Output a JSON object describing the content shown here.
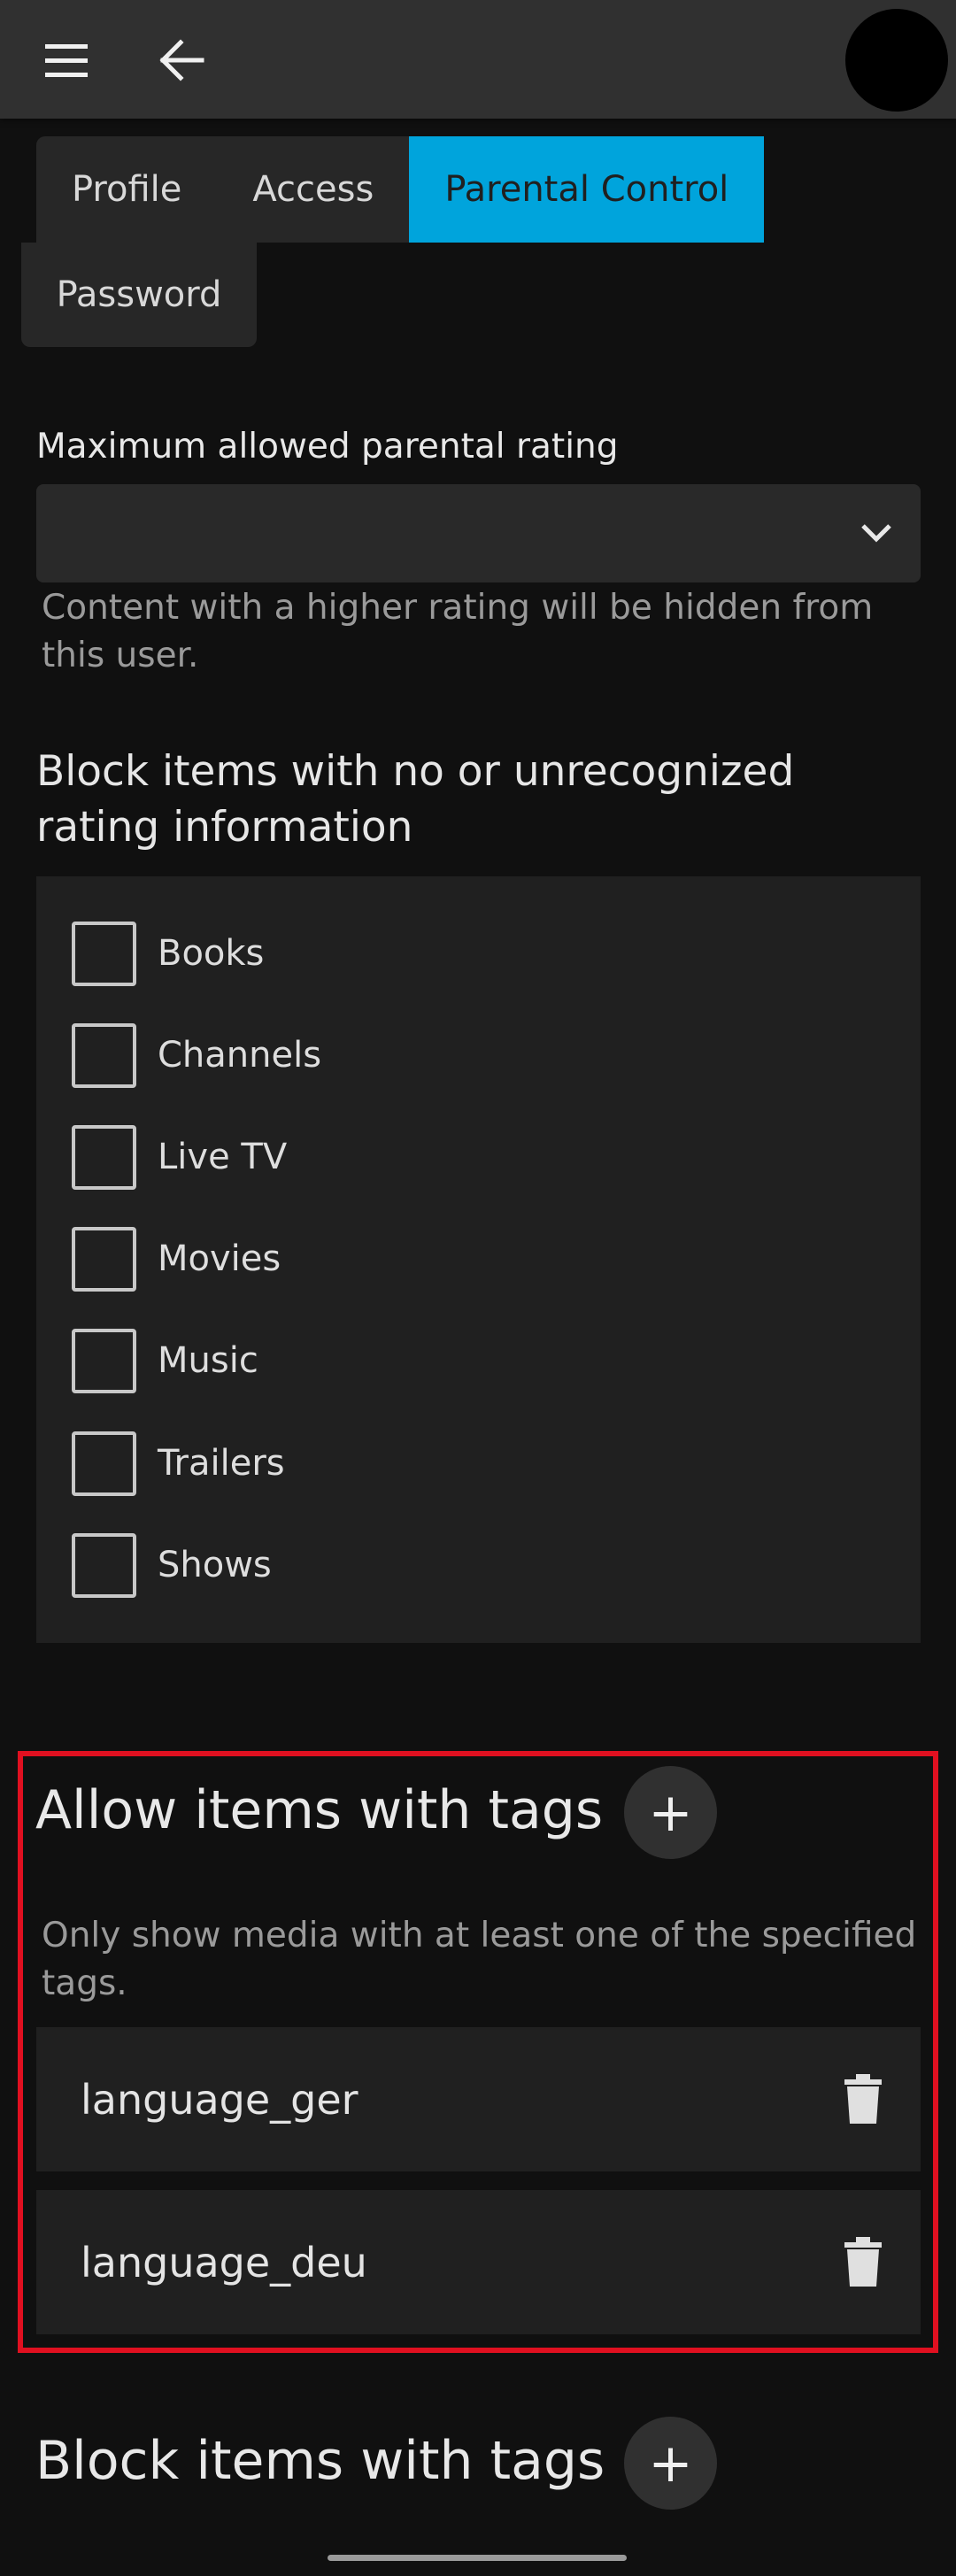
{
  "tabs": [
    "Profile",
    "Access",
    "Parental Control",
    "Password"
  ],
  "active_tab": "Parental Control",
  "parental": {
    "label": "Maximum allowed parental rating",
    "selected_value": "",
    "help": "Content with a higher rating will be hidden from this user."
  },
  "block_unrated": {
    "heading": "Block items with no or unrecognized rating information",
    "items": [
      {
        "label": "Books",
        "checked": false
      },
      {
        "label": "Channels",
        "checked": false
      },
      {
        "label": "Live TV",
        "checked": false
      },
      {
        "label": "Movies",
        "checked": false
      },
      {
        "label": "Music",
        "checked": false
      },
      {
        "label": "Trailers",
        "checked": false
      },
      {
        "label": "Shows",
        "checked": false
      }
    ]
  },
  "allow_tags": {
    "heading": "Allow items with tags",
    "add_symbol": "+",
    "help": "Only show media with at least one of the specified tags.",
    "tags": [
      "language_ger",
      "language_deu"
    ]
  },
  "block_tags": {
    "heading": "Block items with tags",
    "add_symbol": "+"
  },
  "colors": {
    "accent": "#00a4dc",
    "highlight_box": "#e01020",
    "background": "#101010"
  },
  "icons": {
    "menu": "hamburger-menu-icon",
    "back": "arrow-back-icon",
    "dropdown": "chevron-down-icon",
    "delete": "trash-icon"
  }
}
